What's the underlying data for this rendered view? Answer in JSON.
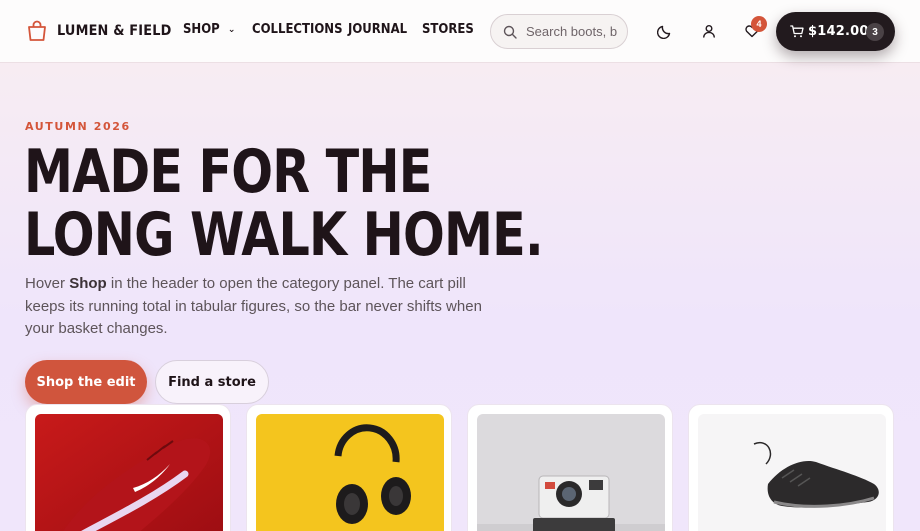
{
  "header": {
    "brand": {
      "name": "LUMEN & FIELD",
      "icon": "shopping-bag-icon"
    },
    "nav": [
      {
        "label": "SHOP",
        "has_dropdown": true
      },
      {
        "label": "COLLECTIONS"
      },
      {
        "label": "JOURNAL"
      },
      {
        "label": "STORES"
      }
    ],
    "search": {
      "placeholder": "Search boots, b",
      "value": ""
    },
    "icons": [
      "moon-icon",
      "user-icon",
      "heart-icon",
      "cart-icon"
    ],
    "wishlist_count": "4",
    "cart": {
      "total": "$142.00",
      "count": "3"
    }
  },
  "hero": {
    "eyebrow": "AUTUMN 2026",
    "title_line1": "MADE FOR THE",
    "title_line2": "LONG WALK HOME.",
    "lede_before": "Hover ",
    "lede_bold": "Shop",
    "lede_after": " in the header to open the category panel. The cart pill keeps its running total in tabular figures, so the bar never shifts when your basket changes.",
    "primary_cta": "Shop the edit",
    "secondary_cta": "Find a store"
  },
  "products": [
    {
      "image": "red running sneaker"
    },
    {
      "image": "black headphones on yellow"
    },
    {
      "image": "instant camera"
    },
    {
      "image": "black sneaker"
    }
  ],
  "colors": {
    "accent": "#d4553a",
    "ink": "#1f1419",
    "cart_pill": "#221a1e"
  }
}
